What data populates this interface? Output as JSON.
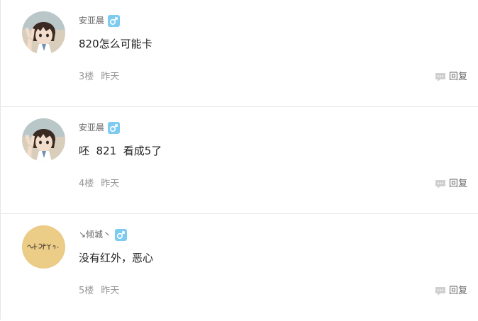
{
  "posts": [
    {
      "username": "安亚晨",
      "gender_icon": "male-icon",
      "content": "820怎么可能卡",
      "floor": "3楼",
      "time": "昨天",
      "reply_label": "回复",
      "avatar": "anime-boy-avatar"
    },
    {
      "username": "安亚晨",
      "gender_icon": "male-icon",
      "content": "呸  821  看成5了",
      "floor": "4楼",
      "time": "昨天",
      "reply_label": "回复",
      "avatar": "anime-boy-avatar"
    },
    {
      "username": "↘倾城丶",
      "gender_icon": "male-icon",
      "content": "没有红外，恶心",
      "floor": "5楼",
      "time": "昨天",
      "reply_label": "回复",
      "avatar": "handwriting-avatar"
    }
  ],
  "colors": {
    "gender_male": "#7ecbf2",
    "divider": "#e8e8e8",
    "meta_text": "#999999"
  }
}
